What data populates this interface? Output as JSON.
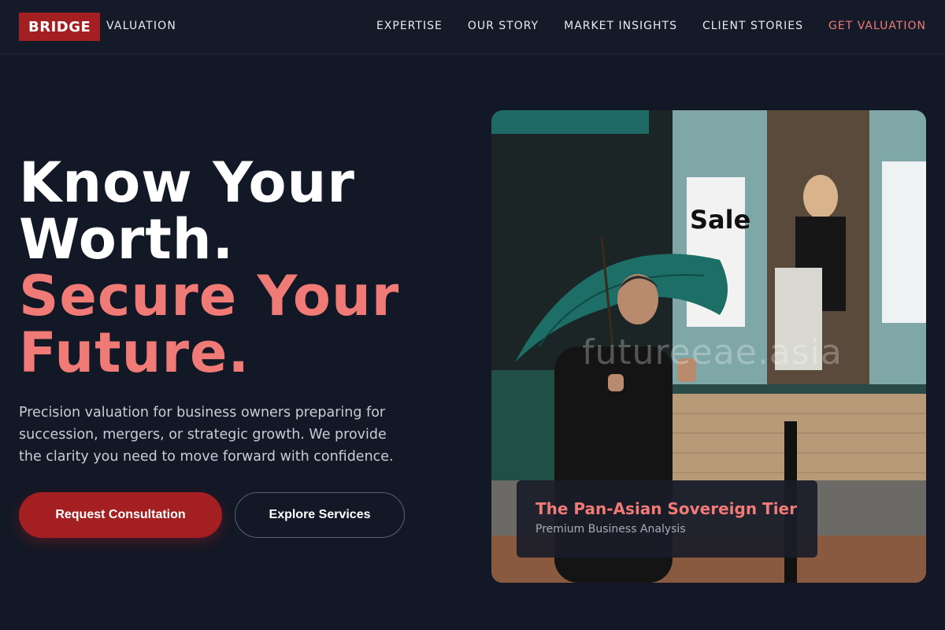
{
  "header": {
    "logo": "BRIDGE",
    "logo_sub": "VALUATION",
    "nav": [
      "EXPERTISE",
      "OUR STORY",
      "MARKET INSIGHTS",
      "CLIENT STORIES",
      "GET VALUATION"
    ]
  },
  "hero": {
    "title_line1": "Know Your",
    "title_line2": "Worth.",
    "title_line3": "Secure Your",
    "title_line4": "Future.",
    "description": "Precision valuation for business owners preparing for succession, mergers, or strategic growth. We provide the clarity you need to move forward with confidence.",
    "primary_button": "Request Consultation",
    "secondary_button": "Explore Services"
  },
  "photo": {
    "watermark": "futureeae.asia",
    "sign_text": "Sale",
    "caption_title": "The Pan-Asian Sovereign Tier",
    "caption_subtitle": "Premium Business Analysis"
  },
  "colors": {
    "background": "#131826",
    "accent": "#f07a76",
    "brand_red": "#a31f21"
  }
}
